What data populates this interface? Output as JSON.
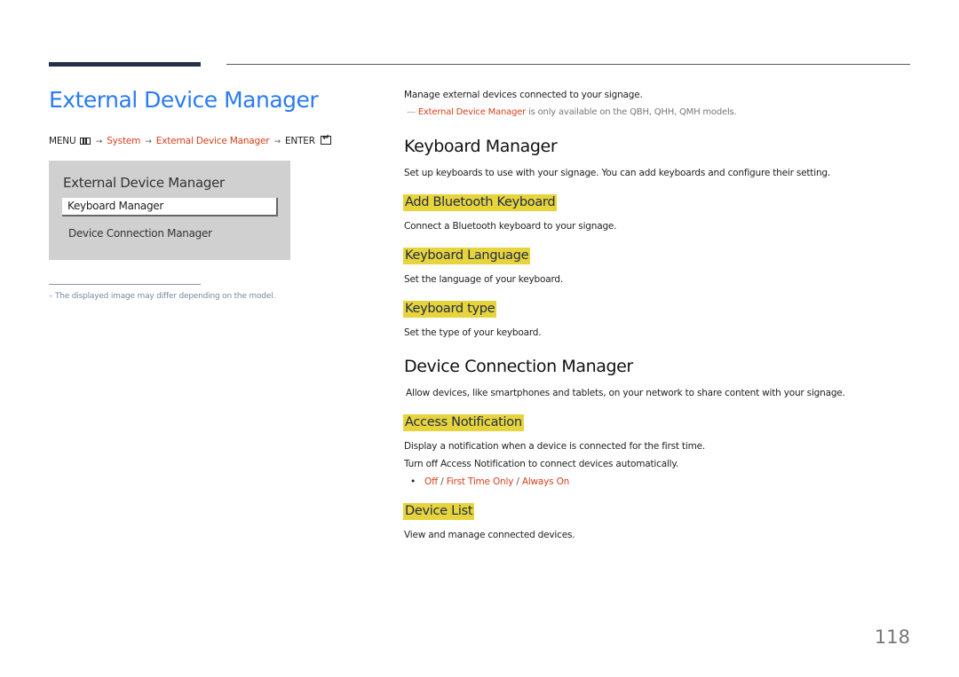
{
  "page": {
    "title": "External Device Manager",
    "number": "118"
  },
  "menu_path": {
    "menu_label": "MENU",
    "menu_icon": "menu-icon",
    "arrow": "→",
    "system": "System",
    "external_device_manager": "External Device Manager",
    "enter_label": "ENTER",
    "enter_icon": "enter-icon"
  },
  "osd": {
    "title": "External Device Manager",
    "items": [
      {
        "label": "Keyboard Manager",
        "selected": true
      },
      {
        "label": "Device Connection Manager",
        "selected": false
      }
    ]
  },
  "left_note": "–  The displayed image may differ depending on the model.",
  "intro": {
    "text": "Manage external devices connected to your signage.",
    "note_dash": "—",
    "note_highlight": "External Device Manager",
    "note_rest": " is only available on the QBH, QHH, QMH models."
  },
  "sections": {
    "keyboard_manager": {
      "heading": "Keyboard Manager",
      "description": "Set up keyboards to use with your signage. You can add keyboards and configure their setting.",
      "subsections": [
        {
          "heading": "Add Bluetooth Keyboard",
          "description": "Connect a Bluetooth keyboard to your signage."
        },
        {
          "heading": "Keyboard Language",
          "description": "Set the language of your keyboard."
        },
        {
          "heading": "Keyboard type",
          "description": "Set the type of your keyboard."
        }
      ]
    },
    "device_connection_manager": {
      "heading": "Device Connection Manager",
      "description": "Allow devices, like smartphones and tablets, on your network to share content with your signage.",
      "access_notification": {
        "heading": "Access Notification",
        "description_1": "Display a notification when a device is connected for the first time.",
        "description_2": "Turn off Access Notification to connect devices automatically.",
        "bullet": "•",
        "options": [
          "Off",
          "First Time Only",
          "Always On"
        ],
        "separator": " / "
      },
      "device_list": {
        "heading": "Device List",
        "description": "View and manage connected devices."
      }
    }
  },
  "colors": {
    "title_blue": "#2b7cf0",
    "accent_red": "#d6401e",
    "highlight_yellow": "#e7d43c",
    "osd_gray": "#d0d0d0",
    "rule_navy": "#252f4a"
  }
}
